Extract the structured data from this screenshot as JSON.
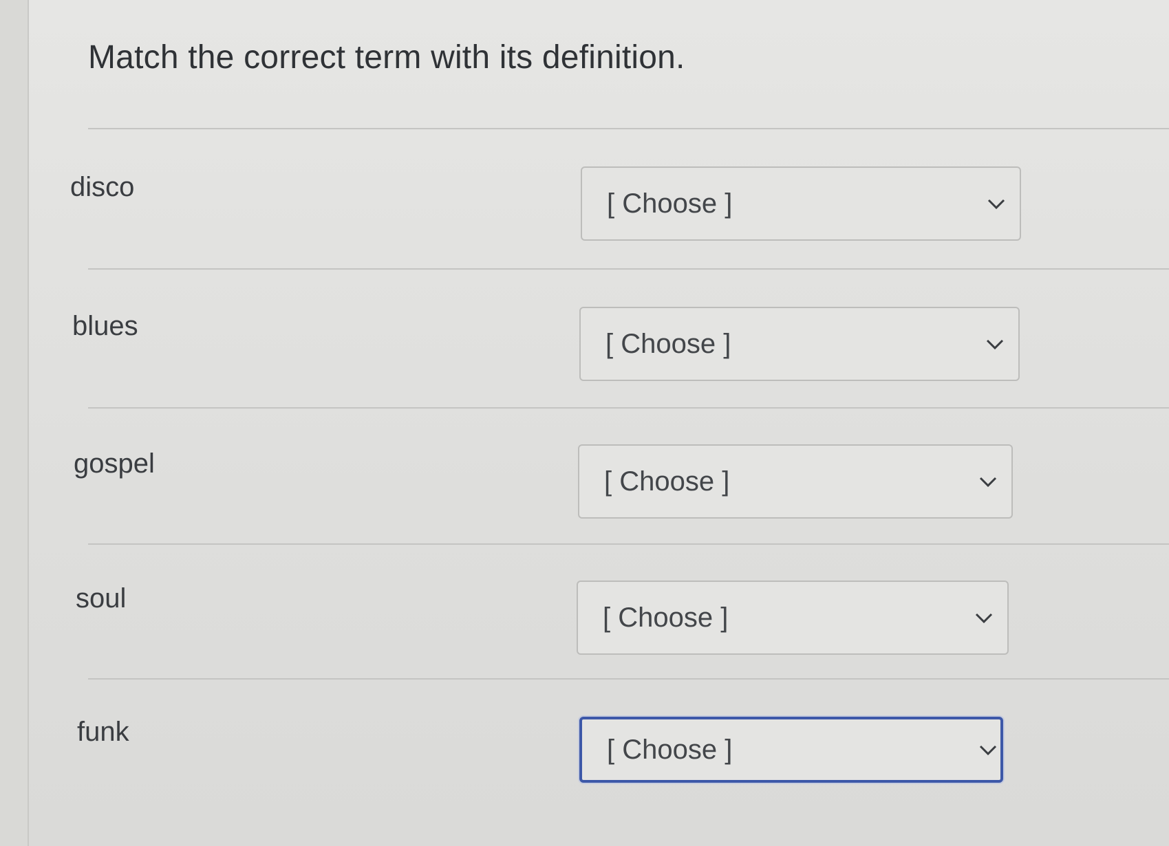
{
  "question": {
    "title": "Match the correct term with its definition."
  },
  "rows": [
    {
      "term": "disco",
      "select_value": "[ Choose ]"
    },
    {
      "term": "blues",
      "select_value": "[ Choose ]"
    },
    {
      "term": "gospel",
      "select_value": "[ Choose ]"
    },
    {
      "term": "soul",
      "select_value": "[ Choose ]"
    },
    {
      "term": "funk",
      "select_value": "[ Choose ]"
    }
  ],
  "icons": {
    "dropdown": "chevron-down-icon"
  },
  "colors": {
    "focus_border": "#3d58a8",
    "text": "#3a3d41"
  }
}
